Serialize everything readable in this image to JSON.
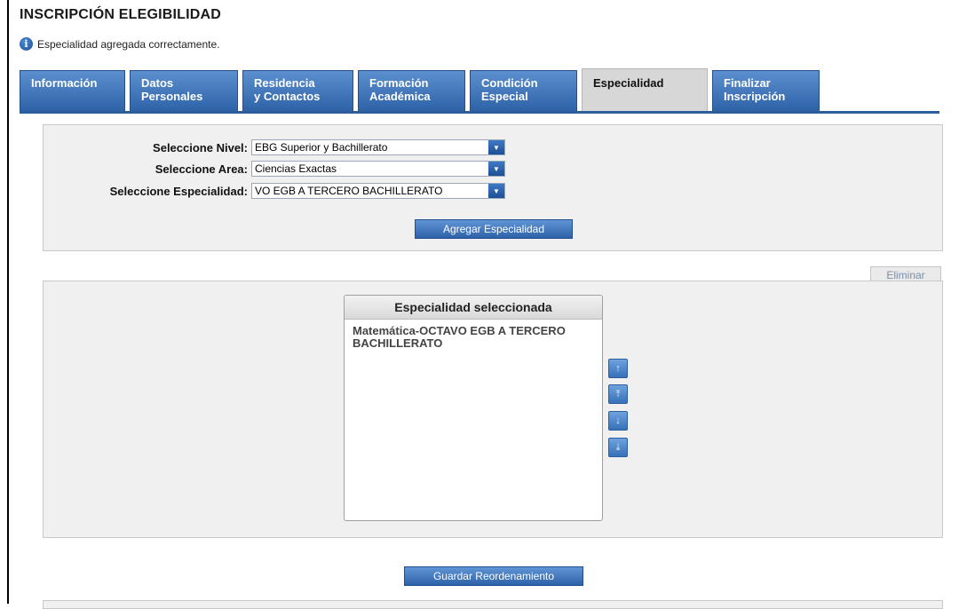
{
  "page": {
    "title": "INSCRIPCIÓN ELEGIBILIDAD",
    "message": "Especialidad agregada correctamente."
  },
  "tabs": [
    {
      "label": "Información",
      "active": false
    },
    {
      "label": "Datos\nPersonales",
      "active": false
    },
    {
      "label": "Residencia\ny Contactos",
      "active": false
    },
    {
      "label": "Formación\nAcadémica",
      "active": false
    },
    {
      "label": "Condición\nEspecial",
      "active": false
    },
    {
      "label": "Especialidad",
      "active": true
    },
    {
      "label": "Finalizar\nInscripción",
      "active": false
    }
  ],
  "form": {
    "nivel_label": "Seleccione Nivel:",
    "nivel_value": "EBG Superior y Bachillerato",
    "area_label": "Seleccione Area:",
    "area_value": "Ciencias Exactas",
    "especialidad_label": "Seleccione Especialidad:",
    "especialidad_value": "VO EGB A TERCERO BACHILLERATO",
    "add_button": "Agregar Especialidad"
  },
  "selection": {
    "delete_button": "Eliminar",
    "list_header": "Especialidad seleccionada",
    "items": [
      "Matemática-OCTAVO EGB A TERCERO BACHILLERATO"
    ],
    "move_buttons": [
      {
        "icon": "arrow-up-icon",
        "glyph": "↑"
      },
      {
        "icon": "move-to-top-icon",
        "glyph": "⤒"
      },
      {
        "icon": "arrow-down-icon",
        "glyph": "↓"
      },
      {
        "icon": "move-to-bottom-icon",
        "glyph": "⤓"
      }
    ],
    "save_button": "Guardar Reordenamiento"
  },
  "colors": {
    "tab_blue": "#2f63a8",
    "active_tab": "#d7d7d7",
    "panel_bg": "#f0f0f0"
  }
}
